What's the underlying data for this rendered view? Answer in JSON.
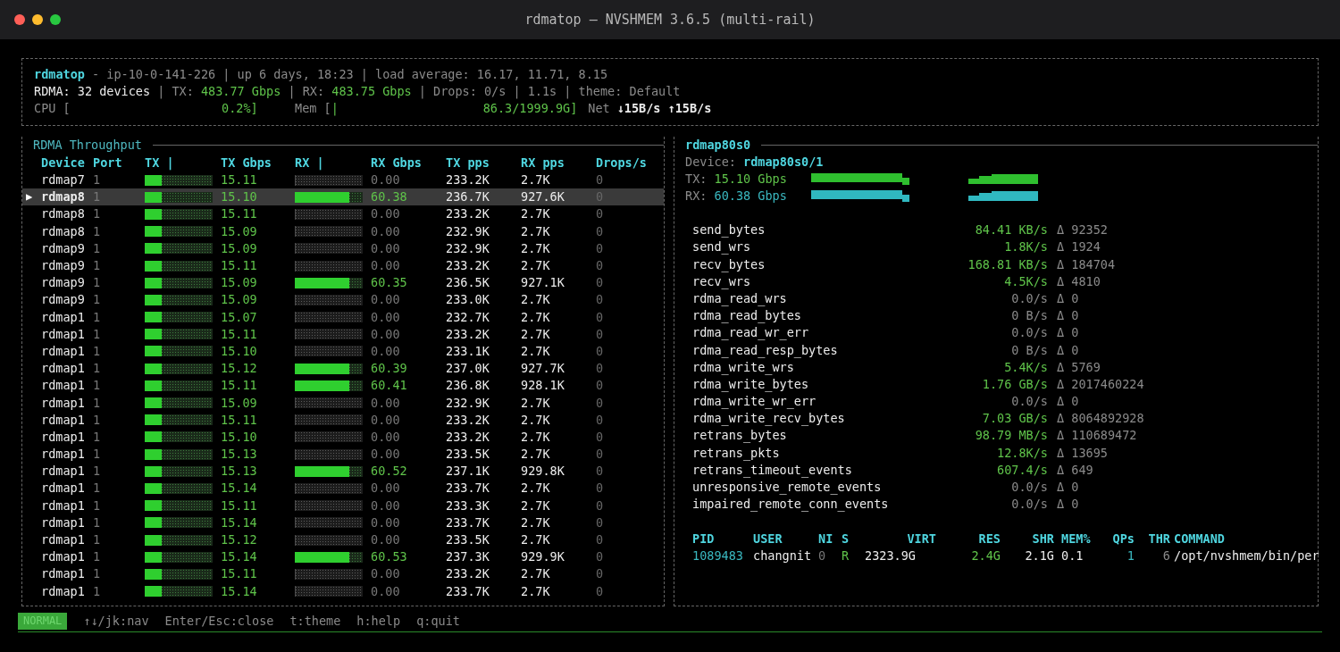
{
  "window": {
    "title": "rdmatop — NVSHMEM 3.6.5 (multi-rail)"
  },
  "header": {
    "lines": [
      [
        {
          "kind": "accent",
          "text": "rdmatop"
        },
        {
          "kind": "dim",
          "text": " - ip-10-0-141-226 | up 6 days, 18:23 | load average: 16.17, 11.71, 8.15"
        }
      ],
      [
        {
          "kind": "bright",
          "text": "RDMA: 32 devices"
        },
        {
          "kind": "dim",
          "text": " | TX: "
        },
        {
          "kind": "value",
          "text": "483.77 Gbps"
        },
        {
          "kind": "dim",
          "text": " | RX: "
        },
        {
          "kind": "value",
          "text": "483.75 Gbps"
        },
        {
          "kind": "dim",
          "text": " | Drops: 0/s | 1.1s | theme: Default"
        }
      ]
    ],
    "cpu": {
      "label": "CPU [",
      "reading": "0.2%]"
    },
    "mem": {
      "label": "Mem [",
      "bar": "|",
      "reading": "86.3/1999.9G]"
    },
    "net": {
      "label": "Net",
      "reading": "↓15B/s ↑15B/s"
    }
  },
  "throughput": {
    "title": "RDMA Throughput",
    "selection_marker": "▶",
    "columns": [
      "Device",
      "Port",
      "TX |",
      "TX Gbps",
      "RX |",
      "RX Gbps",
      "TX pps",
      "RX pps",
      "Drops/s"
    ],
    "rows": [
      {
        "device": "rdmap7",
        "port": "1",
        "tx_bar": {
          "level": 0.25
        },
        "tx_gbps": "15.11",
        "rx_bar": {
          "level": 0
        },
        "rx_gbps": "0.00",
        "tx_pps": "233.2K",
        "rx_pps": "2.7K",
        "drops": "0",
        "selected": false
      },
      {
        "device": "rdmap8",
        "port": "1",
        "tx_bar": {
          "level": 0.25
        },
        "tx_gbps": "15.10",
        "rx_bar": {
          "level": 0.8
        },
        "rx_gbps": "60.38",
        "tx_pps": "236.7K",
        "rx_pps": "927.6K",
        "drops": "0",
        "selected": true
      },
      {
        "device": "rdmap8",
        "port": "1",
        "tx_bar": {
          "level": 0.25
        },
        "tx_gbps": "15.11",
        "rx_bar": {
          "level": 0
        },
        "rx_gbps": "0.00",
        "tx_pps": "233.2K",
        "rx_pps": "2.7K",
        "drops": "0",
        "selected": false
      },
      {
        "device": "rdmap8",
        "port": "1",
        "tx_bar": {
          "level": 0.25
        },
        "tx_gbps": "15.09",
        "rx_bar": {
          "level": 0
        },
        "rx_gbps": "0.00",
        "tx_pps": "232.9K",
        "rx_pps": "2.7K",
        "drops": "0",
        "selected": false
      },
      {
        "device": "rdmap9",
        "port": "1",
        "tx_bar": {
          "level": 0.25
        },
        "tx_gbps": "15.09",
        "rx_bar": {
          "level": 0
        },
        "rx_gbps": "0.00",
        "tx_pps": "232.9K",
        "rx_pps": "2.7K",
        "drops": "0",
        "selected": false
      },
      {
        "device": "rdmap9",
        "port": "1",
        "tx_bar": {
          "level": 0.25
        },
        "tx_gbps": "15.11",
        "rx_bar": {
          "level": 0
        },
        "rx_gbps": "0.00",
        "tx_pps": "233.2K",
        "rx_pps": "2.7K",
        "drops": "0",
        "selected": false
      },
      {
        "device": "rdmap9",
        "port": "1",
        "tx_bar": {
          "level": 0.25
        },
        "tx_gbps": "15.09",
        "rx_bar": {
          "level": 0.8
        },
        "rx_gbps": "60.35",
        "tx_pps": "236.5K",
        "rx_pps": "927.1K",
        "drops": "0",
        "selected": false
      },
      {
        "device": "rdmap9",
        "port": "1",
        "tx_bar": {
          "level": 0.25
        },
        "tx_gbps": "15.09",
        "rx_bar": {
          "level": 0
        },
        "rx_gbps": "0.00",
        "tx_pps": "233.0K",
        "rx_pps": "2.7K",
        "drops": "0",
        "selected": false
      },
      {
        "device": "rdmap1",
        "port": "1",
        "tx_bar": {
          "level": 0.25
        },
        "tx_gbps": "15.07",
        "rx_bar": {
          "level": 0
        },
        "rx_gbps": "0.00",
        "tx_pps": "232.7K",
        "rx_pps": "2.7K",
        "drops": "0",
        "selected": false
      },
      {
        "device": "rdmap1",
        "port": "1",
        "tx_bar": {
          "level": 0.25
        },
        "tx_gbps": "15.11",
        "rx_bar": {
          "level": 0
        },
        "rx_gbps": "0.00",
        "tx_pps": "233.2K",
        "rx_pps": "2.7K",
        "drops": "0",
        "selected": false
      },
      {
        "device": "rdmap1",
        "port": "1",
        "tx_bar": {
          "level": 0.25
        },
        "tx_gbps": "15.10",
        "rx_bar": {
          "level": 0
        },
        "rx_gbps": "0.00",
        "tx_pps": "233.1K",
        "rx_pps": "2.7K",
        "drops": "0",
        "selected": false
      },
      {
        "device": "rdmap1",
        "port": "1",
        "tx_bar": {
          "level": 0.25
        },
        "tx_gbps": "15.12",
        "rx_bar": {
          "level": 0.8
        },
        "rx_gbps": "60.39",
        "tx_pps": "237.0K",
        "rx_pps": "927.7K",
        "drops": "0",
        "selected": false
      },
      {
        "device": "rdmap1",
        "port": "1",
        "tx_bar": {
          "level": 0.25
        },
        "tx_gbps": "15.11",
        "rx_bar": {
          "level": 0.8
        },
        "rx_gbps": "60.41",
        "tx_pps": "236.8K",
        "rx_pps": "928.1K",
        "drops": "0",
        "selected": false
      },
      {
        "device": "rdmap1",
        "port": "1",
        "tx_bar": {
          "level": 0.25
        },
        "tx_gbps": "15.09",
        "rx_bar": {
          "level": 0
        },
        "rx_gbps": "0.00",
        "tx_pps": "232.9K",
        "rx_pps": "2.7K",
        "drops": "0",
        "selected": false
      },
      {
        "device": "rdmap1",
        "port": "1",
        "tx_bar": {
          "level": 0.25
        },
        "tx_gbps": "15.11",
        "rx_bar": {
          "level": 0
        },
        "rx_gbps": "0.00",
        "tx_pps": "233.2K",
        "rx_pps": "2.7K",
        "drops": "0",
        "selected": false
      },
      {
        "device": "rdmap1",
        "port": "1",
        "tx_bar": {
          "level": 0.25
        },
        "tx_gbps": "15.10",
        "rx_bar": {
          "level": 0
        },
        "rx_gbps": "0.00",
        "tx_pps": "233.2K",
        "rx_pps": "2.7K",
        "drops": "0",
        "selected": false
      },
      {
        "device": "rdmap1",
        "port": "1",
        "tx_bar": {
          "level": 0.25
        },
        "tx_gbps": "15.13",
        "rx_bar": {
          "level": 0
        },
        "rx_gbps": "0.00",
        "tx_pps": "233.5K",
        "rx_pps": "2.7K",
        "drops": "0",
        "selected": false
      },
      {
        "device": "rdmap1",
        "port": "1",
        "tx_bar": {
          "level": 0.25
        },
        "tx_gbps": "15.13",
        "rx_bar": {
          "level": 0.8
        },
        "rx_gbps": "60.52",
        "tx_pps": "237.1K",
        "rx_pps": "929.8K",
        "drops": "0",
        "selected": false
      },
      {
        "device": "rdmap1",
        "port": "1",
        "tx_bar": {
          "level": 0.25
        },
        "tx_gbps": "15.14",
        "rx_bar": {
          "level": 0
        },
        "rx_gbps": "0.00",
        "tx_pps": "233.7K",
        "rx_pps": "2.7K",
        "drops": "0",
        "selected": false
      },
      {
        "device": "rdmap1",
        "port": "1",
        "tx_bar": {
          "level": 0.25
        },
        "tx_gbps": "15.11",
        "rx_bar": {
          "level": 0
        },
        "rx_gbps": "0.00",
        "tx_pps": "233.3K",
        "rx_pps": "2.7K",
        "drops": "0",
        "selected": false
      },
      {
        "device": "rdmap1",
        "port": "1",
        "tx_bar": {
          "level": 0.25
        },
        "tx_gbps": "15.14",
        "rx_bar": {
          "level": 0
        },
        "rx_gbps": "0.00",
        "tx_pps": "233.7K",
        "rx_pps": "2.7K",
        "drops": "0",
        "selected": false
      },
      {
        "device": "rdmap1",
        "port": "1",
        "tx_bar": {
          "level": 0.25
        },
        "tx_gbps": "15.12",
        "rx_bar": {
          "level": 0
        },
        "rx_gbps": "0.00",
        "tx_pps": "233.5K",
        "rx_pps": "2.7K",
        "drops": "0",
        "selected": false
      },
      {
        "device": "rdmap1",
        "port": "1",
        "tx_bar": {
          "level": 0.25
        },
        "tx_gbps": "15.14",
        "rx_bar": {
          "level": 0.8
        },
        "rx_gbps": "60.53",
        "tx_pps": "237.3K",
        "rx_pps": "929.9K",
        "drops": "0",
        "selected": false
      },
      {
        "device": "rdmap1",
        "port": "1",
        "tx_bar": {
          "level": 0.25
        },
        "tx_gbps": "15.11",
        "rx_bar": {
          "level": 0
        },
        "rx_gbps": "0.00",
        "tx_pps": "233.2K",
        "rx_pps": "2.7K",
        "drops": "0",
        "selected": false
      },
      {
        "device": "rdmap1",
        "port": "1",
        "tx_bar": {
          "level": 0.25
        },
        "tx_gbps": "15.14",
        "rx_bar": {
          "level": 0
        },
        "rx_gbps": "0.00",
        "tx_pps": "233.7K",
        "rx_pps": "2.7K",
        "drops": "0",
        "selected": false
      }
    ]
  },
  "detail": {
    "title": "rdmap80s0",
    "device_label": "Device:",
    "device": "rdmap80s0/1",
    "tx_label": "TX:",
    "tx_rate": "15.10 Gbps",
    "rx_label": "RX:",
    "rx_rate": "60.38 Gbps",
    "metrics": [
      {
        "name": "send_bytes",
        "rate": "84.41 KB/s",
        "delta": "Δ 92352",
        "active": true
      },
      {
        "name": "send_wrs",
        "rate": "1.8K/s",
        "delta": "Δ 1924",
        "active": true
      },
      {
        "name": "recv_bytes",
        "rate": "168.81 KB/s",
        "delta": "Δ 184704",
        "active": true
      },
      {
        "name": "recv_wrs",
        "rate": "4.5K/s",
        "delta": "Δ 4810",
        "active": true
      },
      {
        "name": "rdma_read_wrs",
        "rate": "0.0/s",
        "delta": "Δ 0",
        "active": false
      },
      {
        "name": "rdma_read_bytes",
        "rate": "0 B/s",
        "delta": "Δ 0",
        "active": false
      },
      {
        "name": "rdma_read_wr_err",
        "rate": "0.0/s",
        "delta": "Δ 0",
        "active": false
      },
      {
        "name": "rdma_read_resp_bytes",
        "rate": "0 B/s",
        "delta": "Δ 0",
        "active": false
      },
      {
        "name": "rdma_write_wrs",
        "rate": "5.4K/s",
        "delta": "Δ 5769",
        "active": true
      },
      {
        "name": "rdma_write_bytes",
        "rate": "1.76 GB/s",
        "delta": "Δ 2017460224",
        "active": true
      },
      {
        "name": "rdma_write_wr_err",
        "rate": "0.0/s",
        "delta": "Δ 0",
        "active": false
      },
      {
        "name": "rdma_write_recv_bytes",
        "rate": "7.03 GB/s",
        "delta": "Δ 8064892928",
        "active": true
      },
      {
        "name": "retrans_bytes",
        "rate": "98.79 MB/s",
        "delta": "Δ 110689472",
        "active": true
      },
      {
        "name": "retrans_pkts",
        "rate": "12.8K/s",
        "delta": "Δ 13695",
        "active": true
      },
      {
        "name": "retrans_timeout_events",
        "rate": "607.4/s",
        "delta": "Δ 649",
        "active": true
      },
      {
        "name": "unresponsive_remote_events",
        "rate": "0.0/s",
        "delta": "Δ 0",
        "active": false
      },
      {
        "name": "impaired_remote_conn_events",
        "rate": "0.0/s",
        "delta": "Δ 0",
        "active": false
      }
    ],
    "process_columns": [
      "PID",
      "USER",
      "NI",
      "S",
      "VIRT",
      "RES",
      "SHR",
      "MEM%",
      "QPs",
      "THR",
      "COMMAND"
    ],
    "processes": [
      {
        "pid": "1089483",
        "user": "changnit",
        "ni": "0",
        "s": "R",
        "virt": "2323.9G",
        "res": "2.4G",
        "shr": "2.1G",
        "mem": "0.1",
        "qps": "1",
        "thr": "6",
        "command": "/opt/nvshmem/bin/per"
      }
    ]
  },
  "footer": {
    "mode": "NORMAL",
    "hints": [
      "↑↓/jk:nav",
      "Enter/Esc:close",
      "t:theme",
      "h:help",
      "q:quit"
    ]
  }
}
